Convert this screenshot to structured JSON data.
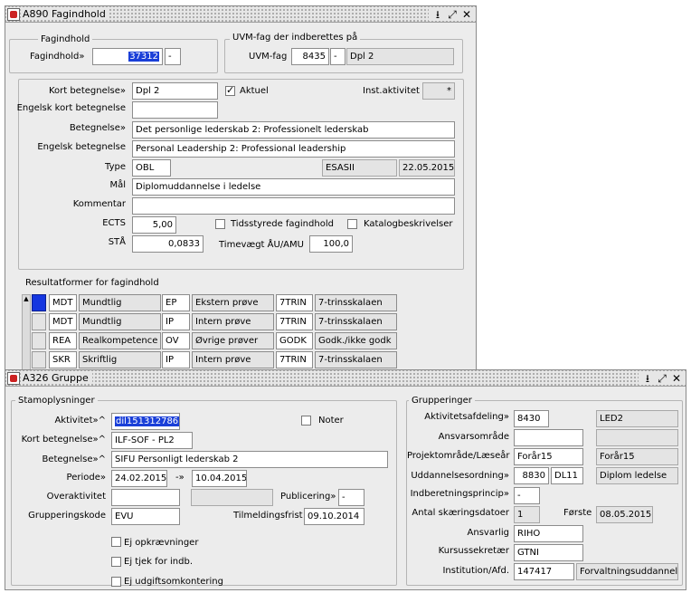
{
  "win1": {
    "title": "A890 Fagindhold",
    "fagindhold_group": "Fagindhold",
    "fagindhold_label": "Fagindhold»",
    "fagindhold_value": "37312",
    "fagindhold_suffix": "-",
    "uvm_group": "UVM-fag der indberettes på",
    "uvm_label": "UVM-fag",
    "uvm_value": "8435",
    "uvm_suffix": "-",
    "uvm_name": "Dpl 2",
    "kort_label": "Kort betegnelse»",
    "kort_value": "Dpl 2",
    "aktuel_label": "Aktuel",
    "inst_label": "Inst.aktivitet",
    "inst_value": "*",
    "engelsk_kort_label": "Engelsk kort betegnelse",
    "engelsk_kort_value": "",
    "betegnelse_label": "Betegnelse»",
    "betegnelse_value": "Det personlige lederskab 2: Professionelt lederskab",
    "engelsk_beteg_label": "Engelsk betegnelse",
    "engelsk_beteg_value": "Personal Leadership 2: Professional leadership",
    "type_label": "Type",
    "type_value": "OBL",
    "type_ro1": "ESASII",
    "type_ro2": "22.05.2015",
    "maal_label": "Mål",
    "maal_value": "Diplomuddannelse i ledelse",
    "kommentar_label": "Kommentar",
    "kommentar_value": "",
    "ects_label": "ECTS",
    "ects_value": "5,00",
    "tidsstyrede_label": "Tidsstyrede fagindhold",
    "katalog_label": "Katalogbeskrivelser",
    "staa_label": "STÅ",
    "staa_value": "0,0833",
    "timevaegt_label": "Timevægt ÅU/AMU",
    "timevaegt_value": "100,0",
    "result_label": "Resultatformer for fagindhold",
    "result_rows": [
      [
        "MDT",
        "Mundtlig",
        "EP",
        "Ekstern prøve",
        "7TRIN",
        "7-trinsskalaen"
      ],
      [
        "MDT",
        "Mundtlig",
        "IP",
        "Intern prøve",
        "7TRIN",
        "7-trinsskalaen"
      ],
      [
        "REA",
        "Realkompetence",
        "OV",
        "Øvrige prøver",
        "GODK",
        "Godk./ikke godk"
      ],
      [
        "SKR",
        "Skriftlig",
        "IP",
        "Intern prøve",
        "7TRIN",
        "7-trinsskalaen"
      ]
    ]
  },
  "win2": {
    "title": "A326 Gruppe",
    "stam_group": "Stamoplysninger",
    "aktivitet_label": "Aktivitet»^",
    "aktivitet_value": "dil151312786",
    "noter_label": "Noter",
    "kort_label": "Kort betegnelse»^",
    "kort_value": "ILF-SOF - PL2",
    "beteg_label": "Betegnelse»^",
    "beteg_value": "SIFU Personligt lederskab 2",
    "periode_label": "Periode»",
    "periode_from": "24.02.2015",
    "periode_arrow": "-»",
    "periode_to": "10.04.2015",
    "overaktivitet_label": "Overaktivitet",
    "publicering_label": "Publicering»",
    "publicering_value": "-",
    "grupperingskode_label": "Grupperingskode",
    "grupperingskode_value": "EVU",
    "tilmeldingsfrist_label": "Tilmeldingsfrist",
    "tilmeldingsfrist_value": "09.10.2014",
    "ej_opkr_label": "Ej opkrævninger",
    "ej_tjek_label": "Ej tjek for indb.",
    "ej_udg_label": "Ej udgiftsomkontering",
    "grp_group": "Grupperinger",
    "aktafd_label": "Aktivitetsafdeling»",
    "aktafd_value": "8430",
    "aktafd_name": "LED2",
    "ansvar_label": "Ansvarsområde",
    "proj_label": "Projektområde/Læseår",
    "proj_value": "Forår15",
    "proj_name": "Forår15",
    "udd_label": "Uddannelsesordning»",
    "udd_value": "8830",
    "udd_code": "DL11",
    "udd_name": "Diplom ledelse",
    "indb_label": "Indberetningsprincip»",
    "indb_value": "-",
    "skaer_label": "Antal skæringsdatoer",
    "skaer_value": "1",
    "forste_label": "Første",
    "forste_value": "08.05.2015",
    "ansvarlig_label": "Ansvarlig",
    "ansvarlig_value": "RIHO",
    "kursus_label": "Kursussekretær",
    "kursus_value": "GTNI",
    "inst_label": "Institution/Afd.",
    "inst_value": "147417",
    "inst_name": "Forvaltningsuddannels"
  },
  "icons": [
    "app-icon",
    "minimize-icon",
    "restore-icon",
    "close-icon"
  ]
}
